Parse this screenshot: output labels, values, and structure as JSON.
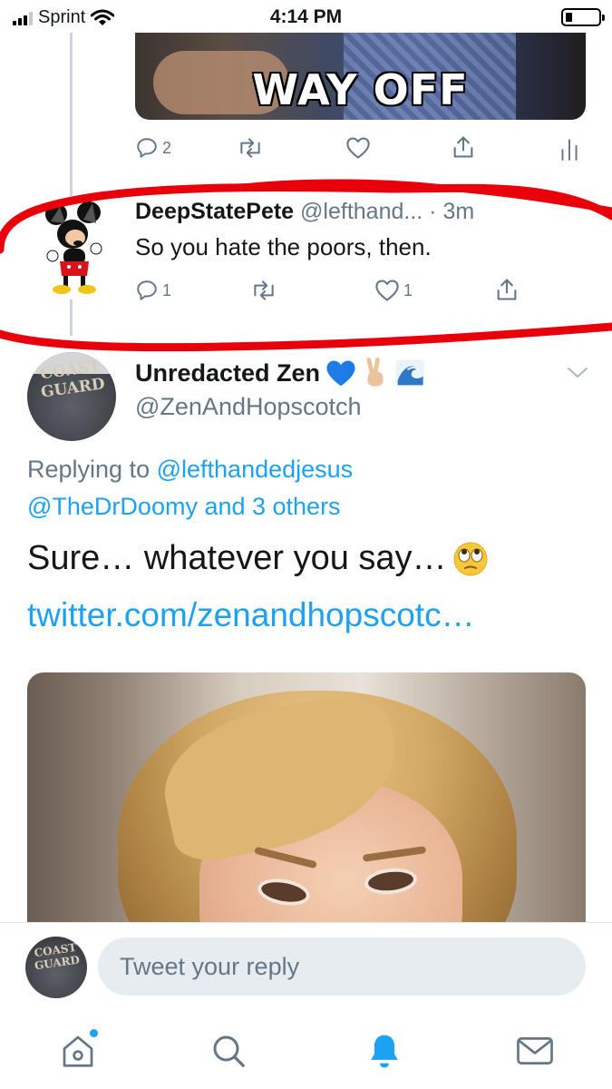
{
  "status_bar": {
    "carrier": "Sprint",
    "time": "4:14 PM"
  },
  "gif": {
    "caption": "WAY OFF"
  },
  "parent_tweet_actions": {
    "reply_count": "2",
    "retweet_count": "",
    "like_count": ""
  },
  "tweet1": {
    "name": "DeepStatePete",
    "handle": "@lefthand...",
    "time": "· 3m",
    "text": "So you hate the poors, then.",
    "reply_count": "1",
    "like_count": "1"
  },
  "tweet2": {
    "name": "Unredacted Zen",
    "handle": "@ZenAndHopscotch",
    "replying_prefix": "Replying to",
    "replying_user": "@lefthandedjesus",
    "replying_more": "@TheDrDoomy and 3 others",
    "text": "Sure… whatever you say…",
    "link": "twitter.com/zenandhopscotc…",
    "avatar_text": "COAST GUARD"
  },
  "reply_bar": {
    "placeholder": "Tweet your reply",
    "avatar_text": "COAST GUARD"
  },
  "colors": {
    "accent": "#1da1f2",
    "secondary_text": "#657786",
    "highlight": "#e8000b"
  },
  "icons": [
    "signal-icon",
    "wifi-icon",
    "battery-icon",
    "reply-icon",
    "retweet-icon",
    "like-icon",
    "share-icon",
    "analytics-icon",
    "chevron-down-icon",
    "home-icon",
    "search-icon",
    "notifications-icon",
    "messages-icon"
  ]
}
